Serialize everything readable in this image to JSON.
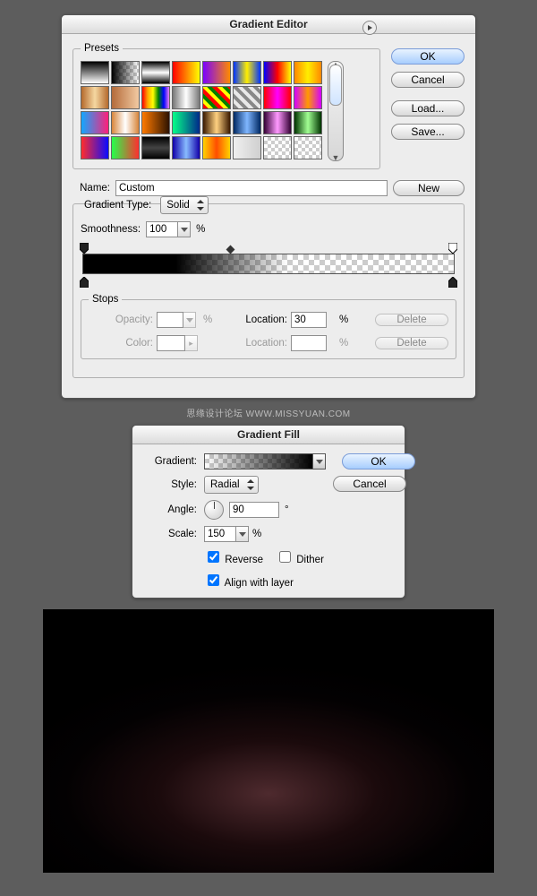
{
  "editor": {
    "title": "Gradient Editor",
    "presets_label": "Presets",
    "buttons": {
      "ok": "OK",
      "cancel": "Cancel",
      "load": "Load...",
      "save": "Save..."
    },
    "name_label": "Name:",
    "name_value": "Custom",
    "new_btn": "New",
    "gradient_type_label": "Gradient Type:",
    "gradient_type_value": "Solid",
    "smoothness_label": "Smoothness:",
    "smoothness_value": "100",
    "stops_label": "Stops",
    "opacity_label": "Opacity:",
    "color_label": "Color:",
    "location_label": "Location:",
    "location_value": "30",
    "location2_value": "",
    "delete_btn": "Delete",
    "percent": "%"
  },
  "fill": {
    "title": "Gradient Fill",
    "gradient_label": "Gradient:",
    "style_label": "Style:",
    "style_value": "Radial",
    "angle_label": "Angle:",
    "angle_value": "90",
    "degree": "°",
    "scale_label": "Scale:",
    "scale_value": "150",
    "reverse": "Reverse",
    "dither": "Dither",
    "align": "Align with layer",
    "ok": "OK",
    "cancel": "Cancel",
    "percent": "%"
  },
  "watermark": "思缘设计论坛 WWW.MISSYUAN.COM",
  "presets": [
    "linear-gradient(#000,#fff)",
    "linear-gradient(to right,#000,transparent),repeating-conic-gradient(#ccc 0 25%,#fff 0 50%) 0 0/8px 8px",
    "linear-gradient(#000,#fff,#000)",
    "linear-gradient(to right,#ff0000,#ffff00)",
    "linear-gradient(to right,#7b00ff,#ff8a00)",
    "linear-gradient(to right,#0033ff,#ffee00,#0033ff)",
    "linear-gradient(to right,#0000ff,#ff0000,#ffff00)",
    "linear-gradient(to right,#ff8800,#ffee00,#ff8800)",
    "linear-gradient(to right,#b56a2d,#f5d7a1,#b56a2d)",
    "linear-gradient(to right,#b46b3a,#f2caa2)",
    "linear-gradient(to right,red,orange,yellow,green,blue,violet)",
    "linear-gradient(to right,#777,#fff,#777)",
    "repeating-linear-gradient(45deg,red 0 4px,yellow 4px 8px,green 8px 12px)",
    "repeating-linear-gradient(45deg,#888 0 4px,#e8e8e8 4px 8px)",
    "linear-gradient(to right,#ff0000,#ff00ff,#ff0000)",
    "linear-gradient(to right,#d400ff,#ff9a00,#d400ff)",
    "linear-gradient(to right,#12a7ff,#ff207a)",
    "linear-gradient(to right,#d8853a,#fff,#d8853a)",
    "linear-gradient(to right,#ff7a00,#2e1300)",
    "linear-gradient(to right,#05ff89,#00298a)",
    "linear-gradient(to right,#3a1a00,#ffd080,#3a1a00)",
    "linear-gradient(to right,#002862,#7fb6ff,#002862)",
    "linear-gradient(to right,#330033,#ff99ff,#330033)",
    "linear-gradient(to right,#003300,#a1ff93,#003300)",
    "linear-gradient(to right,#ff2d2d,#0b0bff)",
    "linear-gradient(to right,#26ff4a,#ff2f2f)",
    "linear-gradient(#000,#444,#000)",
    "linear-gradient(to right,#1100aa,#88bbff,#1100aa)",
    "linear-gradient(to right,#ffd200,#ff4e00,#ffd200)",
    "linear-gradient(to right,#efefef,#cfcfcf)",
    "repeating-conic-gradient(#ccc 0 25%,#fff 0 50%) 0 0/8px 8px",
    "repeating-conic-gradient(#ccc 0 25%,#fff 0 50%) 0 0/8px 8px"
  ]
}
